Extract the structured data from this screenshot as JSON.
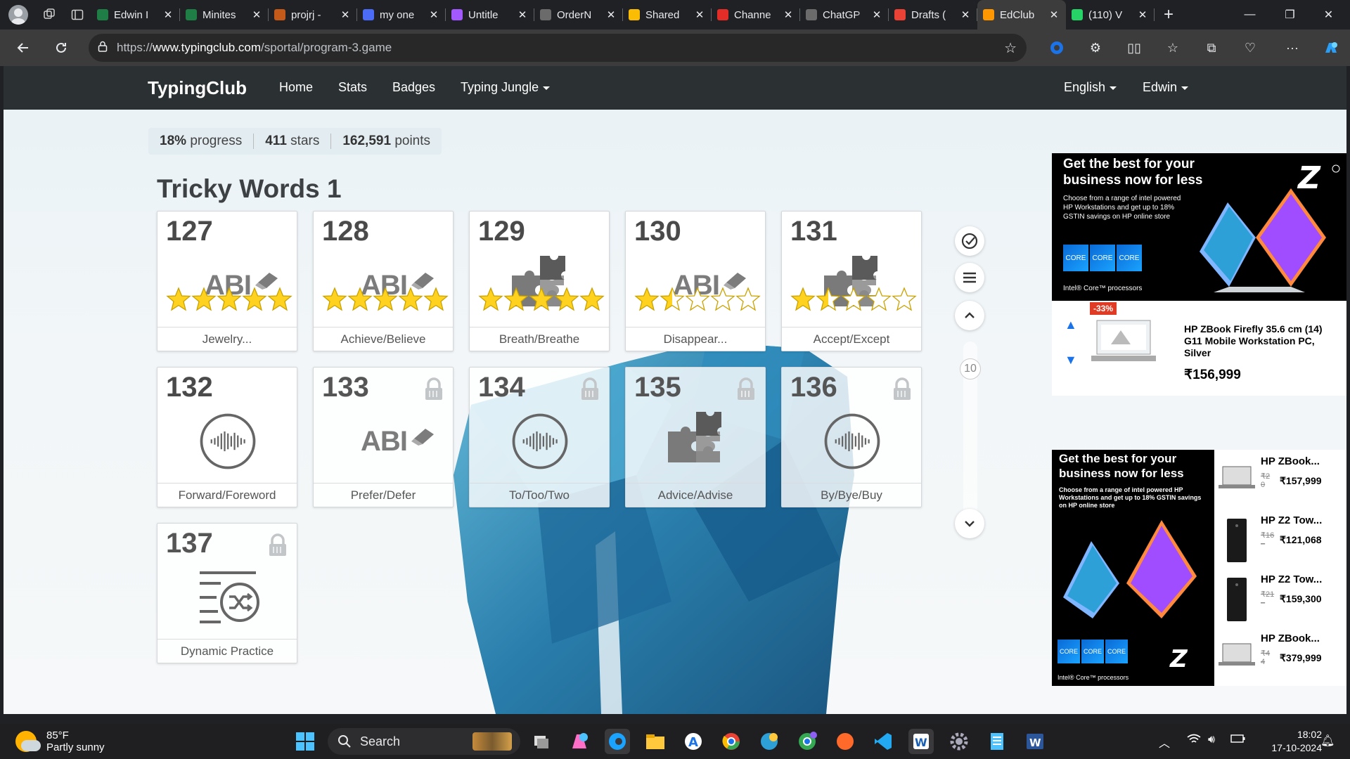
{
  "browser": {
    "tabs": [
      {
        "title": "Edwin I",
        "color": "#1e7e45"
      },
      {
        "title": "Minites",
        "color": "#1e7e45"
      },
      {
        "title": "projrj -",
        "color": "#c45a1a"
      },
      {
        "title": "my one",
        "color": "#4a6cf7"
      },
      {
        "title": "Untitle",
        "color": "#a259ff"
      },
      {
        "title": "OrderN",
        "color": "#6b6b6b"
      },
      {
        "title": "Shared",
        "color": "#fbbc04"
      },
      {
        "title": "Channe",
        "color": "#e52d27"
      },
      {
        "title": "ChatGP",
        "color": "#6b6b6b"
      },
      {
        "title": "Drafts (",
        "color": "#ea4335"
      },
      {
        "title": "EdClub",
        "color": "#ff9800"
      },
      {
        "title": "(110) V",
        "color": "#25d366"
      }
    ],
    "url_prefix": "https://",
    "url_host": "www.typingclub.com",
    "url_path": "/sportal/program-3.game"
  },
  "site": {
    "brand": "TypingClub",
    "nav": {
      "home": "Home",
      "stats": "Stats",
      "badges": "Badges",
      "jungle": "Typing Jungle",
      "language": "English",
      "user": "Edwin"
    }
  },
  "progress": {
    "percent": "18%",
    "percent_label": "progress",
    "stars": "411",
    "stars_label": "stars",
    "points": "162,591",
    "points_label": "points"
  },
  "section_title": "Tricky Words 1",
  "lessons": [
    {
      "num": "127",
      "label": "Jewelry...",
      "icon": "abc",
      "stars": 5,
      "locked": false
    },
    {
      "num": "128",
      "label": "Achieve/Believe",
      "icon": "abc",
      "stars": 5,
      "locked": false
    },
    {
      "num": "129",
      "label": "Breath/Breathe",
      "icon": "puzzle",
      "stars": 5,
      "locked": false
    },
    {
      "num": "130",
      "label": "Disappear...",
      "icon": "abc",
      "stars": 1.5,
      "locked": false
    },
    {
      "num": "131",
      "label": "Accept/Except",
      "icon": "puzzle",
      "stars": 1.5,
      "locked": false
    },
    {
      "num": "132",
      "label": "Forward/Foreword",
      "icon": "audio",
      "stars": 0,
      "locked": false
    },
    {
      "num": "133",
      "label": "Prefer/Defer",
      "icon": "abc",
      "stars": 0,
      "locked": true
    },
    {
      "num": "134",
      "label": "To/Too/Two",
      "icon": "audio",
      "stars": 0,
      "locked": true
    },
    {
      "num": "135",
      "label": "Advice/Advise",
      "icon": "puzzle",
      "stars": 0,
      "locked": true
    },
    {
      "num": "136",
      "label": "By/Bye/Buy",
      "icon": "audio",
      "stars": 0,
      "locked": true
    },
    {
      "num": "137",
      "label": "Dynamic Practice",
      "icon": "shuffle",
      "stars": 0,
      "locked": true
    }
  ],
  "abc_text": "ABI",
  "page_indicator": "10",
  "ad1": {
    "headline": "Get the best for your business now for less",
    "body": "Choose from a range of intel powered HP Workstations and get up to 18% GSTIN savings on HP online store",
    "chip": "CORE",
    "chip_brand": "intel",
    "footer": "Intel® Core™ processors",
    "discount": "-33%",
    "product": "HP ZBook Firefly 35.6 cm (14) G11 Mobile Workstation PC, Silver",
    "price": "₹156,999"
  },
  "ad2": {
    "headline": "Get the best for your business now for less",
    "body": "Choose from a range of intel powered HP Workstations and get up to 18% GSTIN savings on HP online store",
    "chip": "CORE",
    "footer": "Intel® Core™ processors",
    "products": [
      {
        "name": "HP ZBook...",
        "old": "₹2 0",
        "price": "₹157,999"
      },
      {
        "name": "HP Z2 Tow...",
        "old": "₹16 –",
        "price": "₹121,068"
      },
      {
        "name": "HP Z2 Tow...",
        "old": "₹21 –",
        "price": "₹159,300"
      },
      {
        "name": "HP ZBook...",
        "old": "₹4 4",
        "price": "₹379,999"
      }
    ]
  },
  "taskbar": {
    "temp": "85°F",
    "condition": "Partly sunny",
    "search": "Search",
    "time": "18:02",
    "date": "17-10-2024"
  }
}
